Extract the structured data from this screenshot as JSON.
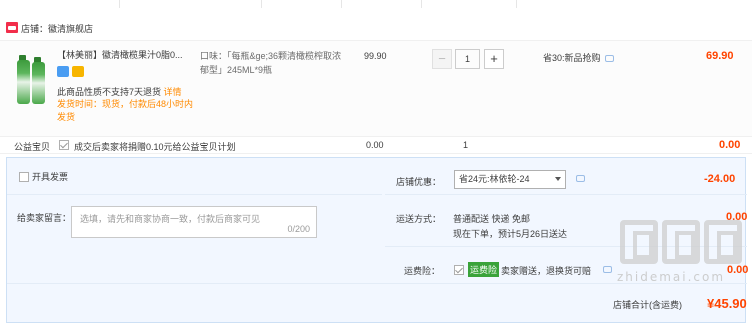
{
  "shop": {
    "name": "店铺：徽清旗舰店"
  },
  "item": {
    "title": "【林美丽】徽清橄榄果汁0脂0...",
    "variant": "口味：「每瓶&ge;36颗清橄榄榨取浓郁型」245ML*9瓶",
    "notice": "此商品性质不支持7天退货",
    "notice_link": "详情",
    "shipping_time": "发货时间：现货，付款后48小时内发货",
    "unit_price": "99.90",
    "quantity": "1",
    "minus_label": "−",
    "plus_label": "+",
    "promotion": "省30:新品抢购",
    "subtotal": "69.90"
  },
  "welfare": {
    "label": "公益宝贝",
    "text": "成交后卖家将捐赠0.10元给公益宝贝计划",
    "price": "0.00",
    "qty": "1",
    "total": "0.00"
  },
  "invoice": {
    "label": "开具发票"
  },
  "message": {
    "label": "给卖家留言：",
    "placeholder": "选填，请先和商家协商一致，付款后商家可见",
    "count": "0/200"
  },
  "coupon": {
    "label": "店铺优惠：",
    "selected": "省24元:林依轮-24",
    "discount": "-24.00"
  },
  "shipping": {
    "label": "运送方式：",
    "method": "普通配送 快递 免邮",
    "eta": "现在下单，预计5月26日送达",
    "fee": "0.00"
  },
  "insurance": {
    "label": "运费险：",
    "tag": "运费险",
    "text": "卖家赠送，退换货可赔",
    "fee": "0.00"
  },
  "total": {
    "label": "店铺合计(含运费)",
    "value": "¥45.90"
  },
  "watermark": {
    "text": "zhidemai.com"
  },
  "colors": {
    "accent": "#ff4400",
    "panel_bg": "#f2f7ff",
    "orange_link": "#ff8a00"
  }
}
